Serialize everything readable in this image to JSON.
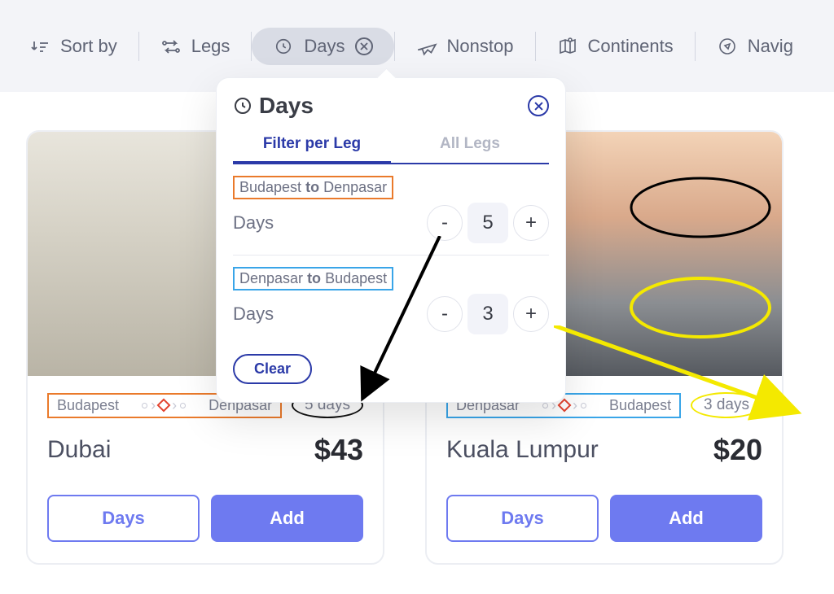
{
  "filterbar": {
    "sort": "Sort by",
    "legs": "Legs",
    "days": "Days",
    "nonstop": "Nonstop",
    "continents": "Continents",
    "navig": "Navig"
  },
  "popover": {
    "title": "Days",
    "tab_per_leg": "Filter per Leg",
    "tab_all": "All Legs",
    "leg1": {
      "from": "Budapest",
      "to_word": "to",
      "to": "Denpasar",
      "label": "Days",
      "value": "5"
    },
    "leg2": {
      "from": "Denpasar",
      "to_word": "to",
      "to": "Budapest",
      "label": "Days",
      "value": "3"
    },
    "clear": "Clear"
  },
  "cards": [
    {
      "from": "Budapest",
      "to": "Denpasar",
      "route_color": "orange",
      "days": "5 days",
      "pill_color": "black",
      "city": "Dubai",
      "price": "$43",
      "btn_days": "Days",
      "btn_add": "Add"
    },
    {
      "from": "Denpasar",
      "to": "Budapest",
      "route_color": "blue",
      "days": "3 days",
      "pill_color": "yellow",
      "city": "Kuala Lumpur",
      "price": "$20",
      "btn_days": "Days",
      "btn_add": "Add"
    }
  ]
}
